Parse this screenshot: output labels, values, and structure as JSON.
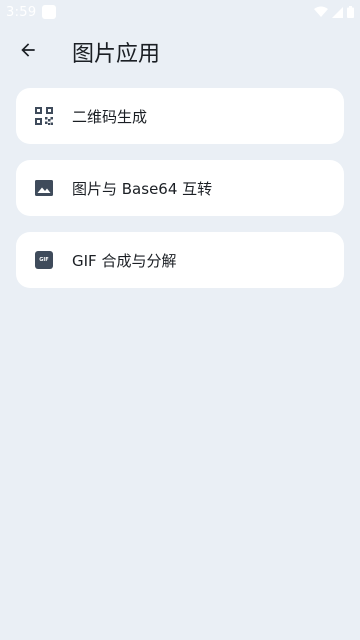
{
  "status_bar": {
    "time": "3:59",
    "icons": [
      "notification-square-icon",
      "wifi-icon",
      "signal-icon",
      "battery-icon"
    ]
  },
  "app_bar": {
    "back_icon": "arrow-left-icon",
    "title": "图片应用"
  },
  "items": [
    {
      "icon": "qr-code-icon",
      "label": "二维码生成"
    },
    {
      "icon": "image-icon",
      "label": "图片与 Base64 互转"
    },
    {
      "icon": "gif-icon",
      "icon_text": "GIF",
      "label": "GIF 合成与分解"
    }
  ],
  "colors": {
    "background": "#eaeff5",
    "card": "#ffffff",
    "icon": "#3f4b5b",
    "text": "#1b1f24"
  }
}
